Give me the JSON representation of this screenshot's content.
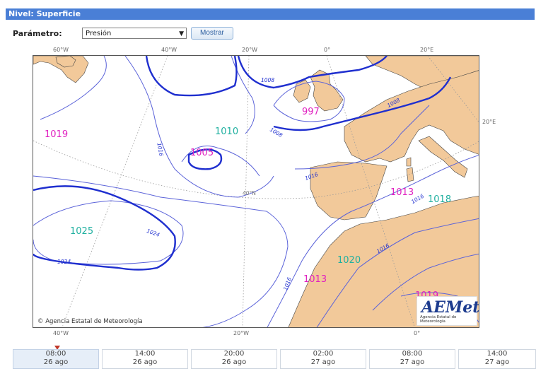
{
  "header": {
    "title": "Nivel: Superficie"
  },
  "form": {
    "param_label": "Parámetro:",
    "selected": "Presión",
    "button": "Mostrar"
  },
  "map": {
    "top_labels": [
      "60°W",
      "40°W",
      "20°W",
      "0°",
      "20°E"
    ],
    "right_labels": [
      "20°E"
    ],
    "bottom_labels": [
      "40°W",
      "20°W",
      "0°"
    ],
    "lat_label": "40°N",
    "pressure_centers": [
      {
        "value": "1019",
        "color": "#e020c0"
      },
      {
        "value": "1005",
        "color": "#e020c0"
      },
      {
        "value": "997",
        "color": "#e020c0"
      },
      {
        "value": "1010",
        "color": "#20b0a0"
      },
      {
        "value": "1025",
        "color": "#20b0a0"
      },
      {
        "value": "1013",
        "color": "#e020c0"
      },
      {
        "value": "1018",
        "color": "#20b0a0"
      },
      {
        "value": "1020",
        "color": "#20b0a0"
      },
      {
        "value": "1013",
        "color": "#e020c0"
      },
      {
        "value": "1019",
        "color": "#e020c0"
      }
    ],
    "isobar_labels": [
      "1008",
      "1008",
      "1008",
      "1016",
      "1016",
      "1024",
      "1024",
      "1016",
      "1016",
      "1016"
    ],
    "copyright": "Agencia Estatal de Meteorología",
    "logo_text": "AEMet",
    "logo_sub": "Agencia Estatal de Meteorología",
    "colors": {
      "land": "#f2c99a",
      "isobar": "#5b63d9",
      "isobar_bold": "#1f2fcf",
      "grid": "#9a9a9a",
      "low": "#e020c0",
      "high": "#20b0a0"
    }
  },
  "timeline": [
    {
      "time": "08:00",
      "date": "26 ago"
    },
    {
      "time": "14:00",
      "date": "26 ago"
    },
    {
      "time": "20:00",
      "date": "26 ago"
    },
    {
      "time": "02:00",
      "date": "27 ago"
    },
    {
      "time": "08:00",
      "date": "27 ago"
    },
    {
      "time": "14:00",
      "date": "27 ago"
    }
  ]
}
